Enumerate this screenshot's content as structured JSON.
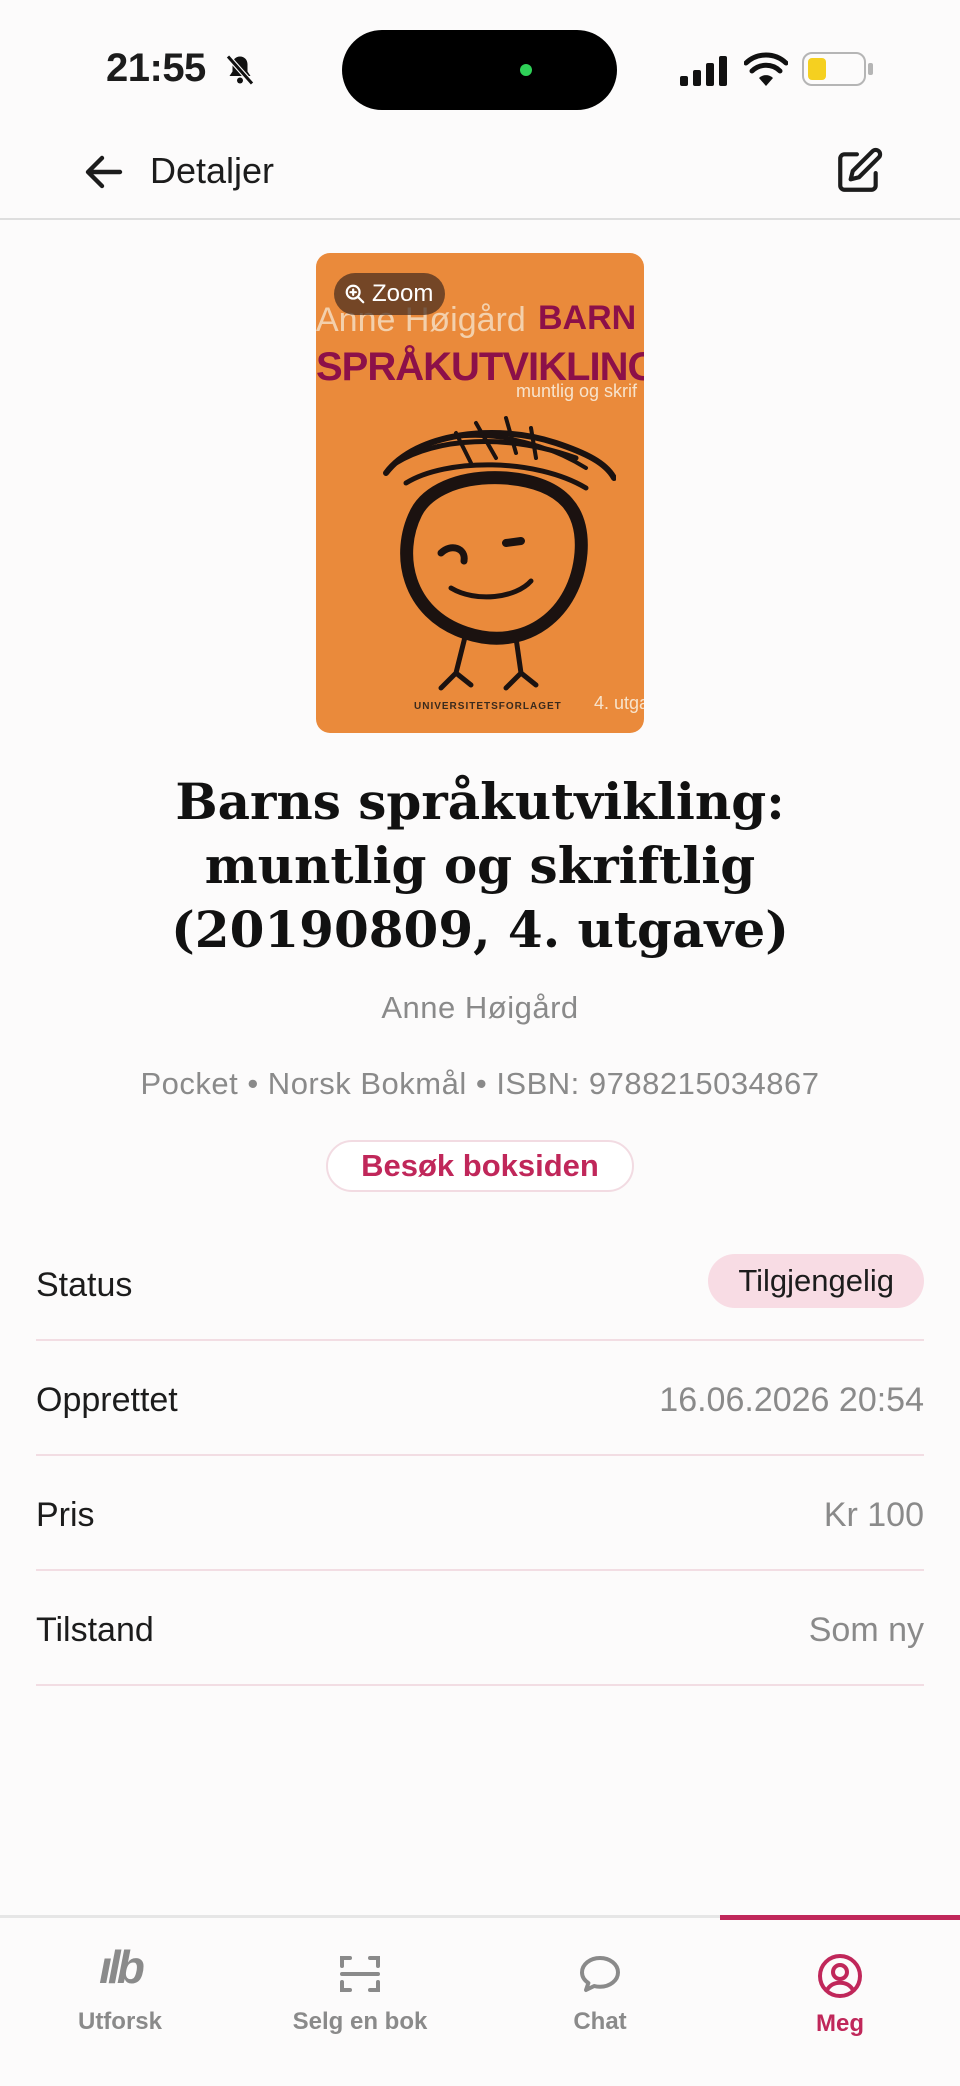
{
  "status_bar": {
    "time": "21:55",
    "icons": [
      "bell-slash-icon",
      "signal-icon",
      "wifi-icon",
      "battery-low-icon"
    ],
    "battery_color": "#f5d020"
  },
  "header": {
    "title": "Detaljer",
    "back_icon": "arrow-left-icon",
    "edit_icon": "edit-icon"
  },
  "cover": {
    "zoom_label": "Zoom",
    "author_text": "Anne Høigård",
    "title_word_1": "BARN",
    "title_word_2": "SPRÅKUTVIKLING",
    "subtitle_text": "muntlig og skrif",
    "publisher_text": "UNIVERSITETSFORLAGET",
    "edition_text": "4. utga",
    "background_color": "#ea8a3b"
  },
  "book": {
    "title": "Barns språkutvikling: muntlig og skriftlig (20190809, 4. utgave)",
    "author": "Anne Høigård",
    "meta": "Pocket • Norsk Bokmål • ISBN: 9788215034867",
    "visit_label": "Besøk boksiden"
  },
  "details": {
    "status": {
      "label": "Status",
      "value": "Tilgjengelig"
    },
    "created": {
      "label": "Opprettet",
      "value": "16.06.2026 20:54"
    },
    "price": {
      "label": "Pris",
      "value": "Kr 100"
    },
    "condition": {
      "label": "Tilstand",
      "value": "Som ny"
    }
  },
  "nav": {
    "explore": {
      "label": "Utforsk",
      "logo": "ılb"
    },
    "sell": {
      "label": "Selg en bok"
    },
    "chat": {
      "label": "Chat"
    },
    "me": {
      "label": "Meg"
    }
  },
  "colors": {
    "accent": "#c0275a",
    "badge_bg": "#f8dce4",
    "muted_text": "#8a8a8a"
  }
}
